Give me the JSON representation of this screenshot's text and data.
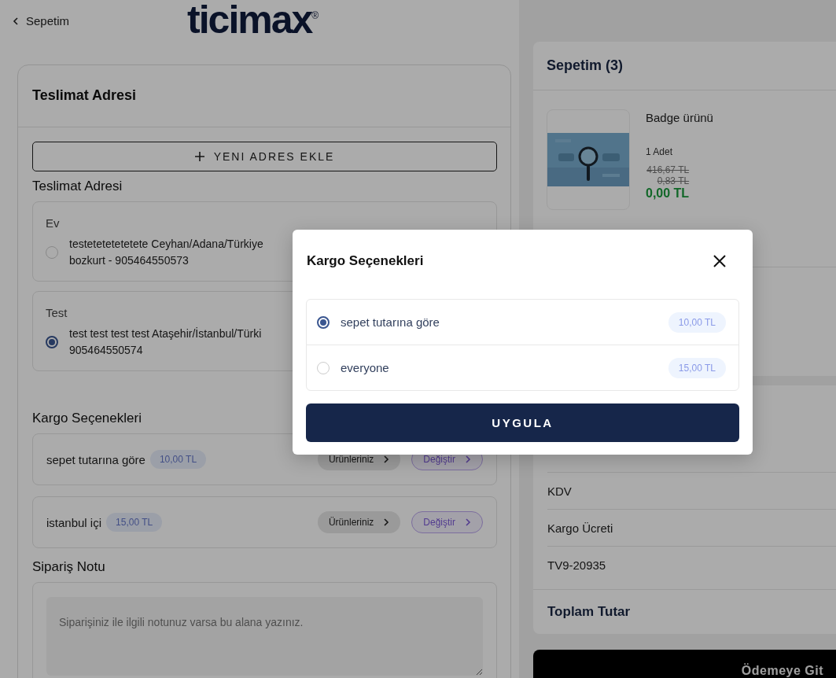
{
  "header": {
    "back_label": "Sepetim",
    "logo": "ticimax",
    "logo_mark": "®"
  },
  "delivery": {
    "title": "Teslimat Adresi",
    "add_button": "YENI ADRES EKLE",
    "address_label": "Teslimat Adresi",
    "addresses": [
      {
        "name": "Ev",
        "line1": "testetetetetetete Ceyhan/Adana/Türkiye",
        "line2": "bozkurt - 905464550573",
        "selected": false
      },
      {
        "name": "Test",
        "line1": "test test test test Ataşehir/İstanbul/Türki",
        "line2": "905464550574",
        "selected": true
      }
    ]
  },
  "shipping": {
    "title": "Kargo Seçenekleri",
    "options": [
      {
        "name": "sepet tutarına göre",
        "price": "10,00 TL",
        "products_button": "Ürünleriniz",
        "change_button": "Değiştir"
      },
      {
        "name": "istanbul içi",
        "price": "15,00 TL",
        "products_button": "Ürünleriniz",
        "change_button": "Değiştir"
      }
    ]
  },
  "order_note": {
    "title": "Sipariş Notu",
    "placeholder": "Siparişiniz ile ilgili notunuz varsa bu alana yazınız."
  },
  "cart": {
    "title": "Sepetim (3)",
    "items": [
      {
        "name": "Badge ürünü",
        "quantity": "1 Adet",
        "old_prices": [
          "416,67 TL",
          "0,83 TL"
        ],
        "price": "0,00 TL",
        "image": {
          "kind": "picture"
        }
      }
    ]
  },
  "summary": {
    "rows": [
      "KDV",
      "Kargo Ücreti",
      "TV9-20935"
    ],
    "total_label": "Toplam Tutar"
  },
  "checkout_button": "Ödemeye Git",
  "modal": {
    "title": "Kargo Seçenekleri",
    "options": [
      {
        "name": "sepet tutarına göre",
        "price": "10,00 TL",
        "selected": true
      },
      {
        "name": "everyone",
        "price": "15,00 TL",
        "selected": false
      }
    ],
    "apply_button": "UYGULA"
  }
}
